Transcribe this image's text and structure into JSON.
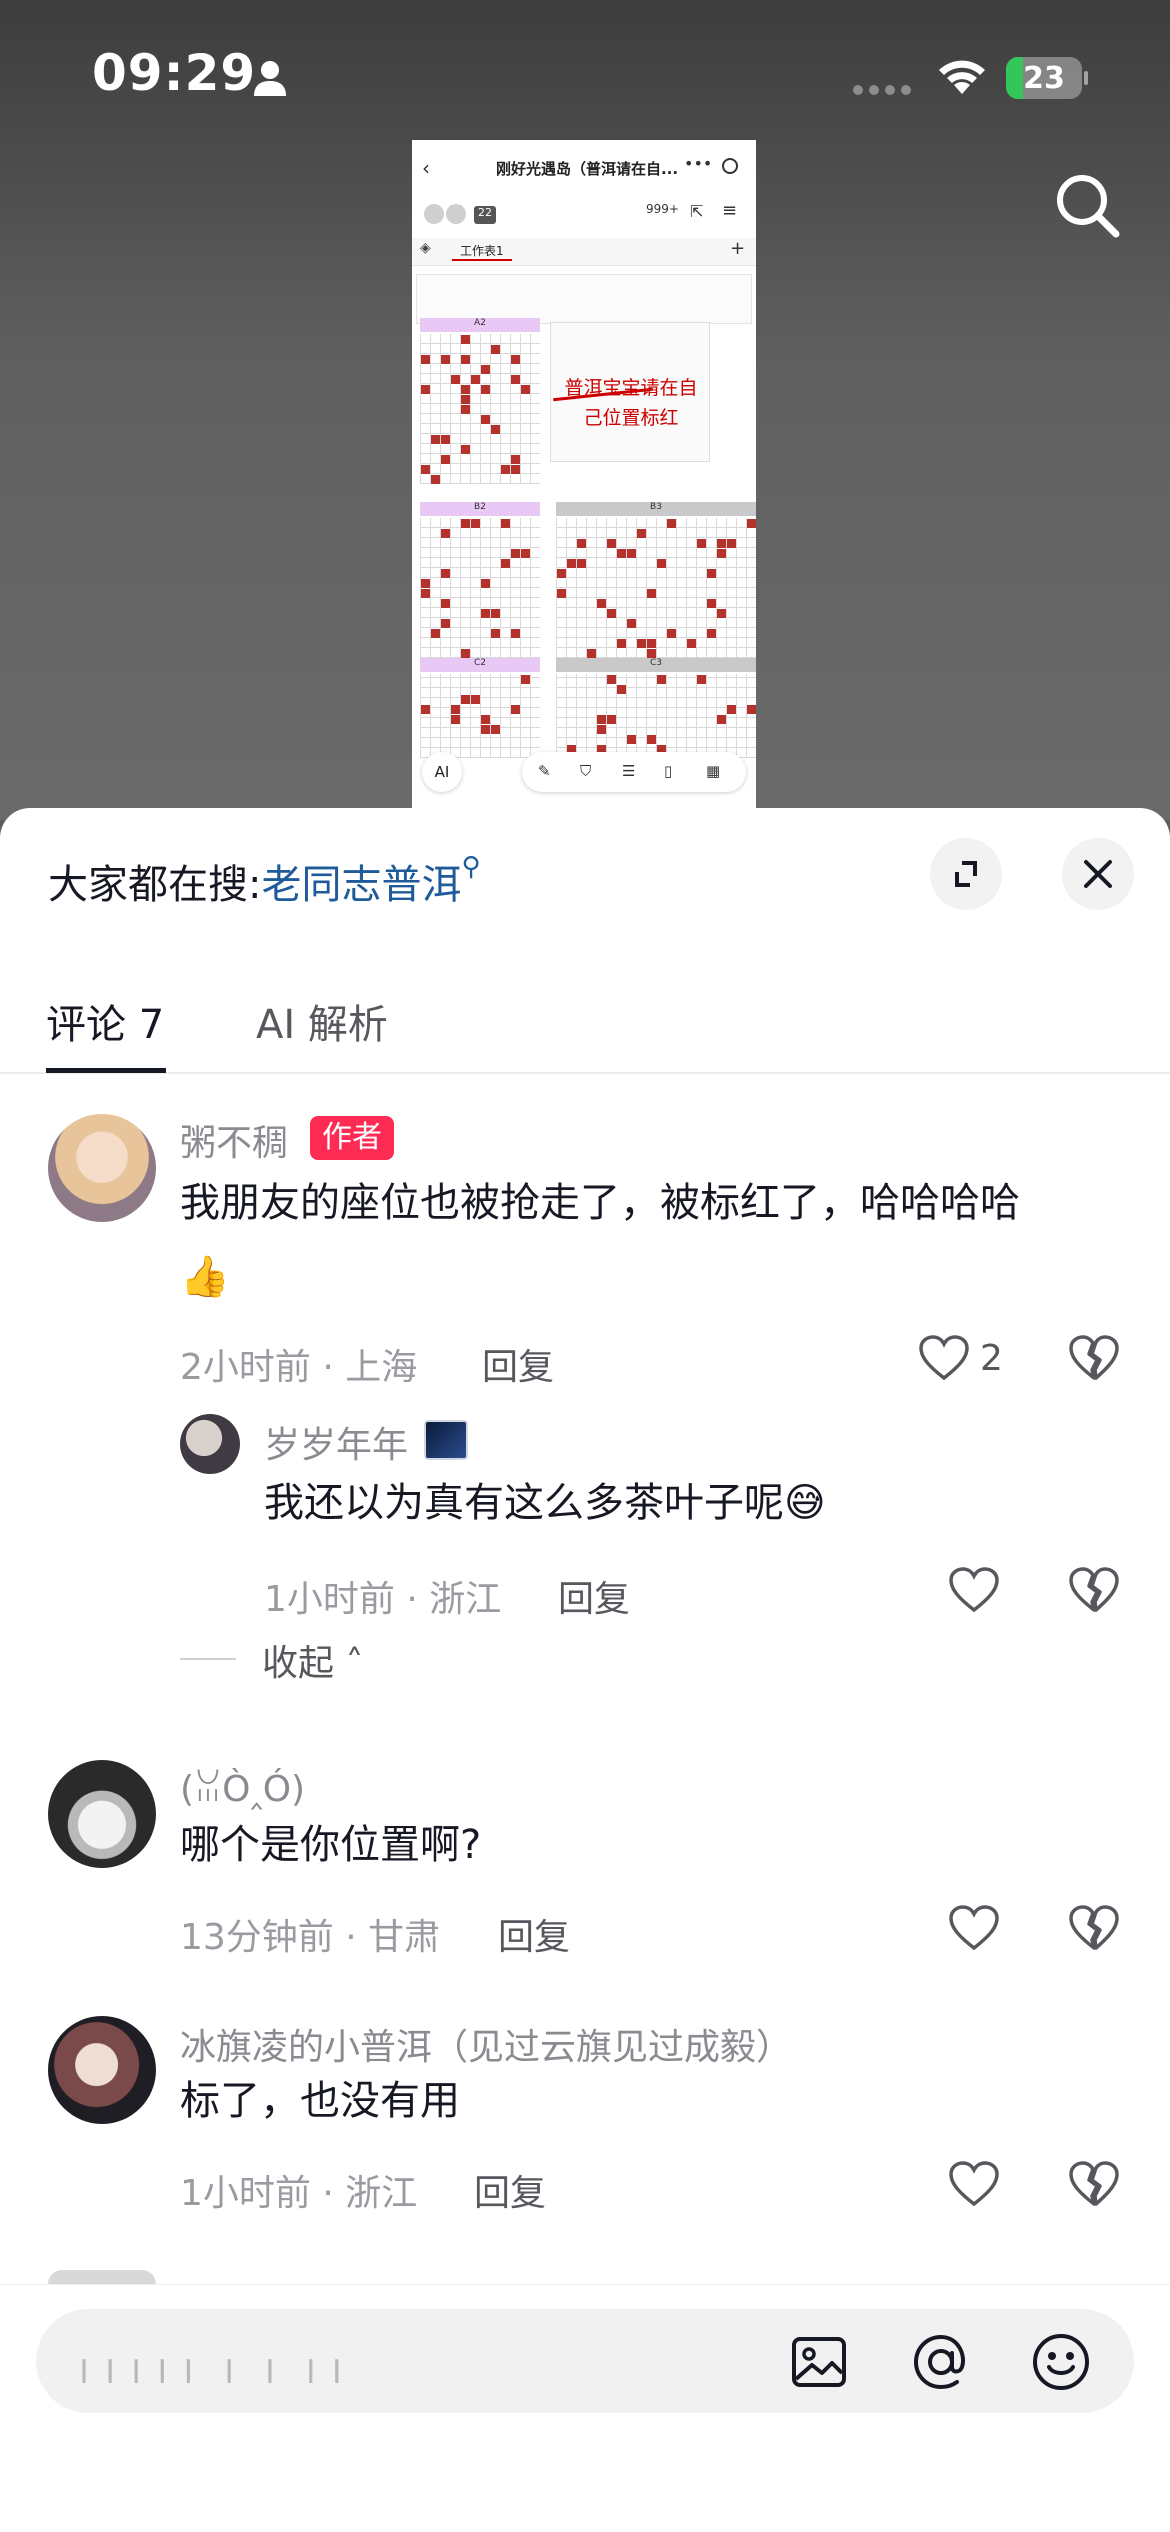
{
  "status_bar": {
    "time": "09:29",
    "battery": "23",
    "battery_level": 0.23
  },
  "preview": {
    "title": "刚好光遇岛（普洱请在自...",
    "count_badge": "22",
    "users_badge": "999+",
    "sheet_tab": "工作表1",
    "blocks": [
      "A2",
      "B2",
      "B3",
      "C2",
      "C3"
    ],
    "note": "普洱宝宝请在自己位置标红",
    "ai_label": "AI"
  },
  "sheet": {
    "search_hint_prefix": "大家都在搜:",
    "search_hint_keyword": "老同志普洱",
    "tabs": [
      "评论 7",
      "AI 解析"
    ]
  },
  "comments": [
    {
      "user": "粥不稠",
      "badge": "作者",
      "text_line1": "我朋友的座位也被抢走了，被标红了，哈哈哈哈",
      "text_line2": "👍",
      "meta": "2小时前 · 上海",
      "reply": "回复",
      "likes": "2"
    },
    {
      "user": "岁岁年年",
      "text": "我还以为真有这么多茶叶子呢😅",
      "meta": "1小时前 · 浙江",
      "reply": "回复"
    },
    {
      "user": "(ꈍÒ‸Ó)",
      "text": "哪个是你位置啊?",
      "meta": "13分钟前 · 甘肃",
      "reply": "回复"
    },
    {
      "user": "冰旗凌的小普洱（见过云旗见过成毅）",
      "text": "标了，也没有用",
      "meta": "1小时前 · 浙江",
      "reply": "回复"
    }
  ],
  "collapse_label": "收起",
  "input": {
    "placeholder": "╷╷╷╷╷ ╷ ╷ ╷╷"
  },
  "colors": {
    "accent": "#fe2c55",
    "keyword": "#1f5a9a",
    "battery": "#33c759"
  },
  "icons": [
    "person-icon",
    "wifi-icon",
    "search-icon",
    "expand-icon",
    "close-icon",
    "heart-icon",
    "broken-heart-icon",
    "image-icon",
    "at-icon",
    "emoji-icon"
  ]
}
